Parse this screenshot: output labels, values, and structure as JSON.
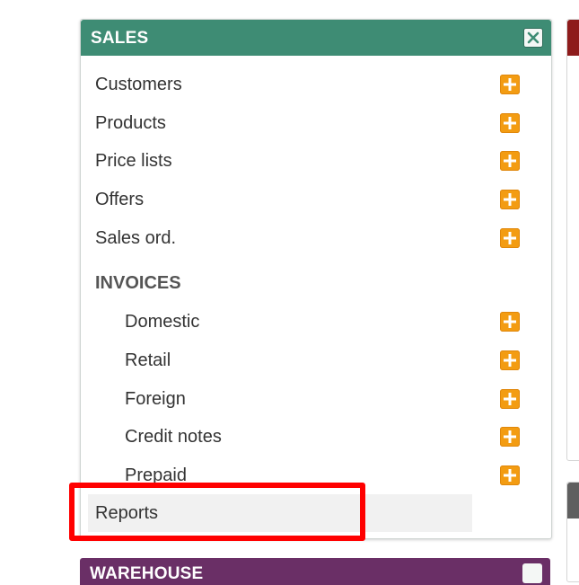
{
  "panel": {
    "title": "SALES",
    "close_label": "close"
  },
  "menu": {
    "items": [
      {
        "label": "Customers"
      },
      {
        "label": "Products"
      },
      {
        "label": "Price lists"
      },
      {
        "label": "Offers"
      },
      {
        "label": "Sales ord."
      }
    ],
    "invoices_heading": "INVOICES",
    "invoice_items": [
      {
        "label": "Domestic"
      },
      {
        "label": "Retail"
      },
      {
        "label": "Foreign"
      },
      {
        "label": "Credit notes"
      },
      {
        "label": "Prepaid"
      }
    ],
    "reports_label": "Reports"
  },
  "next_panel": {
    "title": "WAREHOUSE"
  },
  "colors": {
    "sales_header": "#3e8c74",
    "add_button": "#f39c12",
    "highlight": "#ff0000",
    "warehouse_header": "#6a2f66"
  }
}
